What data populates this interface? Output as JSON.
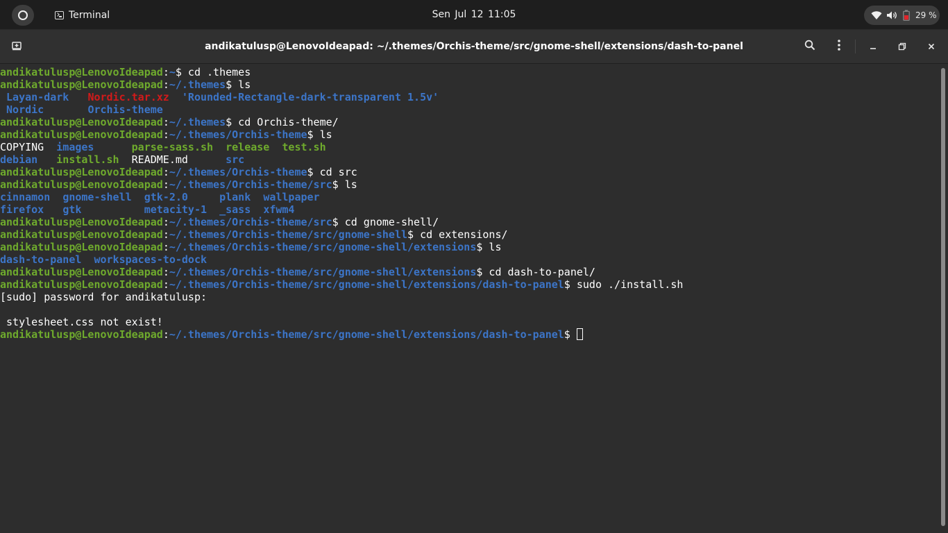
{
  "topbar": {
    "activities_icon": "activities-ring-icon",
    "app_name": "Terminal",
    "app_icon": "terminal-icon",
    "clock": "Sen Jul 12  11:05",
    "battery_percent": "29 %",
    "icons": [
      "wifi-icon",
      "volume-icon",
      "battery-icon"
    ],
    "battery_color": "#e0252b"
  },
  "headerbar": {
    "title": "andikatulusp@LenovoIdeapad: ~/.themes/Orchis-theme/src/gnome-shell/extensions/dash-to-panel",
    "icons": [
      "new-tab-icon",
      "search-icon",
      "menu-icon",
      "minimize-icon",
      "maximize-icon",
      "close-icon"
    ]
  },
  "terminal": {
    "prompt_user": "andikatulusp@LenovoIdeapad",
    "colors": {
      "user": "#6fab2d",
      "path": "#3c75c8",
      "archive": "#d31a1a",
      "text": "#ffffff",
      "background": "#2d2d2d"
    },
    "lines": [
      [
        {
          "t": "andikatulusp@LenovoIdeapad",
          "c": "user"
        },
        {
          "t": ":"
        },
        {
          "t": "~",
          "c": "path"
        },
        {
          "t": "$ cd .themes"
        }
      ],
      [
        {
          "t": "andikatulusp@LenovoIdeapad",
          "c": "user"
        },
        {
          "t": ":"
        },
        {
          "t": "~/.themes",
          "c": "path"
        },
        {
          "t": "$ ls"
        }
      ],
      [
        {
          "t": " "
        },
        {
          "t": "Layan-dark",
          "c": "dir"
        },
        {
          "t": "   "
        },
        {
          "t": "Nordic.tar.xz",
          "c": "arc"
        },
        {
          "t": "  "
        },
        {
          "t": "'Rounded-Rectangle-dark-transparent 1.5v'",
          "c": "dir"
        }
      ],
      [
        {
          "t": " "
        },
        {
          "t": "Nordic",
          "c": "dir"
        },
        {
          "t": "       "
        },
        {
          "t": "Orchis-theme",
          "c": "dir"
        }
      ],
      [
        {
          "t": "andikatulusp@LenovoIdeapad",
          "c": "user"
        },
        {
          "t": ":"
        },
        {
          "t": "~/.themes",
          "c": "path"
        },
        {
          "t": "$ cd Orchis-theme/"
        }
      ],
      [
        {
          "t": "andikatulusp@LenovoIdeapad",
          "c": "user"
        },
        {
          "t": ":"
        },
        {
          "t": "~/.themes/Orchis-theme",
          "c": "path"
        },
        {
          "t": "$ ls"
        }
      ],
      [
        {
          "t": "COPYING  "
        },
        {
          "t": "images",
          "c": "dir"
        },
        {
          "t": "      "
        },
        {
          "t": "parse-sass.sh",
          "c": "exe"
        },
        {
          "t": "  "
        },
        {
          "t": "release",
          "c": "exe"
        },
        {
          "t": "  "
        },
        {
          "t": "test.sh",
          "c": "exe"
        }
      ],
      [
        {
          "t": "debian",
          "c": "dir"
        },
        {
          "t": "   "
        },
        {
          "t": "install.sh",
          "c": "exe"
        },
        {
          "t": "  README.md      "
        },
        {
          "t": "src",
          "c": "dir"
        }
      ],
      [
        {
          "t": "andikatulusp@LenovoIdeapad",
          "c": "user"
        },
        {
          "t": ":"
        },
        {
          "t": "~/.themes/Orchis-theme",
          "c": "path"
        },
        {
          "t": "$ cd src"
        }
      ],
      [
        {
          "t": "andikatulusp@LenovoIdeapad",
          "c": "user"
        },
        {
          "t": ":"
        },
        {
          "t": "~/.themes/Orchis-theme/src",
          "c": "path"
        },
        {
          "t": "$ ls"
        }
      ],
      [
        {
          "t": "cinnamon",
          "c": "dir"
        },
        {
          "t": "  "
        },
        {
          "t": "gnome-shell",
          "c": "dir"
        },
        {
          "t": "  "
        },
        {
          "t": "gtk-2.0",
          "c": "dir"
        },
        {
          "t": "     "
        },
        {
          "t": "plank",
          "c": "dir"
        },
        {
          "t": "  "
        },
        {
          "t": "wallpaper",
          "c": "dir"
        }
      ],
      [
        {
          "t": "firefox",
          "c": "dir"
        },
        {
          "t": "   "
        },
        {
          "t": "gtk",
          "c": "dir"
        },
        {
          "t": "          "
        },
        {
          "t": "metacity-1",
          "c": "dir"
        },
        {
          "t": "  "
        },
        {
          "t": "_sass",
          "c": "dir"
        },
        {
          "t": "  "
        },
        {
          "t": "xfwm4",
          "c": "dir"
        }
      ],
      [
        {
          "t": "andikatulusp@LenovoIdeapad",
          "c": "user"
        },
        {
          "t": ":"
        },
        {
          "t": "~/.themes/Orchis-theme/src",
          "c": "path"
        },
        {
          "t": "$ cd gnome-shell/"
        }
      ],
      [
        {
          "t": "andikatulusp@LenovoIdeapad",
          "c": "user"
        },
        {
          "t": ":"
        },
        {
          "t": "~/.themes/Orchis-theme/src/gnome-shell",
          "c": "path"
        },
        {
          "t": "$ cd extensions/"
        }
      ],
      [
        {
          "t": "andikatulusp@LenovoIdeapad",
          "c": "user"
        },
        {
          "t": ":"
        },
        {
          "t": "~/.themes/Orchis-theme/src/gnome-shell/extensions",
          "c": "path"
        },
        {
          "t": "$ ls"
        }
      ],
      [
        {
          "t": "dash-to-panel",
          "c": "dir"
        },
        {
          "t": "  "
        },
        {
          "t": "workspaces-to-dock",
          "c": "dir"
        }
      ],
      [
        {
          "t": "andikatulusp@LenovoIdeapad",
          "c": "user"
        },
        {
          "t": ":"
        },
        {
          "t": "~/.themes/Orchis-theme/src/gnome-shell/extensions",
          "c": "path"
        },
        {
          "t": "$ cd dash-to-panel/"
        }
      ],
      [
        {
          "t": "andikatulusp@LenovoIdeapad",
          "c": "user"
        },
        {
          "t": ":"
        },
        {
          "t": "~/.themes/Orchis-theme/src/gnome-shell/extensions/dash-to-panel",
          "c": "path"
        },
        {
          "t": "$ sudo ./install.sh"
        }
      ],
      [
        {
          "t": "[sudo] password for andikatulusp: "
        }
      ],
      [
        {
          "t": ""
        }
      ],
      [
        {
          "t": " stylesheet.css not exist!"
        }
      ],
      [
        {
          "t": "andikatulusp@LenovoIdeapad",
          "c": "user"
        },
        {
          "t": ":"
        },
        {
          "t": "~/.themes/Orchis-theme/src/gnome-shell/extensions/dash-to-panel",
          "c": "path"
        },
        {
          "t": "$ "
        }
      ]
    ]
  }
}
